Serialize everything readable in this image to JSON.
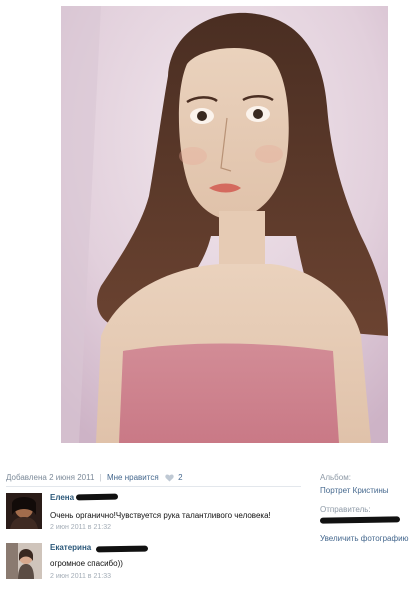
{
  "photo": {
    "icon": "portrait-drawing"
  },
  "meta": {
    "added": "Добавлена 2 июня 2011",
    "separator": "|",
    "like_label": "Мне нравится",
    "like_icon": "heart-icon",
    "like_count": "2"
  },
  "comments": [
    {
      "author": "Елена",
      "text": "Очень органично!Чувствуется рука талантливого человека!",
      "time": "2 июн 2011 в 21:32"
    },
    {
      "author": "Екатерина",
      "text": "огромное спасибо))",
      "time": "2 июн 2011 в 21:33"
    }
  ],
  "sidebar": {
    "album_label": "Альбом:",
    "album_name": "Портрет Кристины",
    "sender_label": "Отправитель:",
    "tag_link": "Увеличить фотографию"
  },
  "colors": {
    "link": "#45688e",
    "author": "#2b587a",
    "muted": "#7c8a99"
  }
}
